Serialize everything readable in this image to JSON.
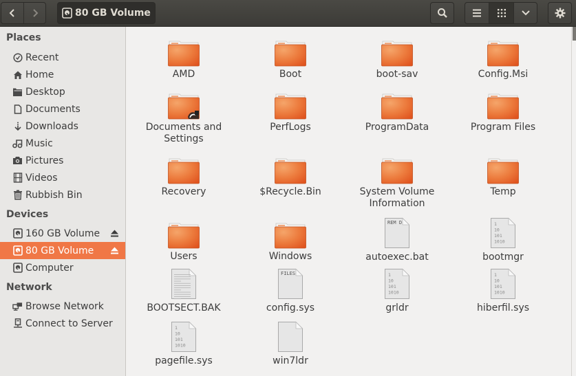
{
  "header": {
    "back_icon": "chevron-left-icon",
    "forward_icon": "chevron-right-icon",
    "location": {
      "icon": "drive-harddisk-icon",
      "label": "80 GB Volume"
    },
    "search_icon": "search-icon",
    "view_list_icon": "list-view-icon",
    "view_grid_icon": "grid-view-icon",
    "view_options_icon": "chevron-down-icon",
    "menu_icon": "gear-icon",
    "active_view": "grid"
  },
  "sidebar": {
    "places_heading": "Places",
    "places": [
      {
        "label": "Recent",
        "icon": "clock-icon"
      },
      {
        "label": "Home",
        "icon": "home-icon"
      },
      {
        "label": "Desktop",
        "icon": "folder-icon"
      },
      {
        "label": "Documents",
        "icon": "document-icon"
      },
      {
        "label": "Downloads",
        "icon": "download-icon"
      },
      {
        "label": "Music",
        "icon": "music-icon"
      },
      {
        "label": "Pictures",
        "icon": "camera-icon"
      },
      {
        "label": "Videos",
        "icon": "film-icon"
      },
      {
        "label": "Rubbish Bin",
        "icon": "trash-icon"
      }
    ],
    "devices_heading": "Devices",
    "devices": [
      {
        "label": "160 GB Volume",
        "icon": "drive-harddisk-icon",
        "eject": true,
        "selected": false
      },
      {
        "label": "80 GB Volume",
        "icon": "drive-harddisk-icon",
        "eject": true,
        "selected": true
      },
      {
        "label": "Computer",
        "icon": "drive-harddisk-icon",
        "eject": false,
        "selected": false
      }
    ],
    "network_heading": "Network",
    "network": [
      {
        "label": "Browse Network",
        "icon": "network-icon"
      },
      {
        "label": "Connect to Server",
        "icon": "server-icon"
      }
    ]
  },
  "files": [
    {
      "name": "AMD",
      "type": "folder"
    },
    {
      "name": "Boot",
      "type": "folder"
    },
    {
      "name": "boot-sav",
      "type": "folder"
    },
    {
      "name": "Config.Msi",
      "type": "folder"
    },
    {
      "name": "Documents and Settings",
      "type": "folder-link"
    },
    {
      "name": "PerfLogs",
      "type": "folder"
    },
    {
      "name": "ProgramData",
      "type": "folder"
    },
    {
      "name": "Program Files",
      "type": "folder"
    },
    {
      "name": "Recovery",
      "type": "folder"
    },
    {
      "name": "$Recycle.Bin",
      "type": "folder"
    },
    {
      "name": "System Volume Information",
      "type": "folder"
    },
    {
      "name": "Temp",
      "type": "folder"
    },
    {
      "name": "Users",
      "type": "folder"
    },
    {
      "name": "Windows",
      "type": "folder"
    },
    {
      "name": "autoexec.bat",
      "type": "script",
      "preview": "REM D"
    },
    {
      "name": "bootmgr",
      "type": "binary",
      "preview": "1\n10\n101\n1010"
    },
    {
      "name": "BOOTSECT.BAK",
      "type": "text"
    },
    {
      "name": "config.sys",
      "type": "script",
      "preview": "FILES"
    },
    {
      "name": "grldr",
      "type": "binary",
      "preview": "1\n10\n101\n1010"
    },
    {
      "name": "hiberfil.sys",
      "type": "binary",
      "preview": "1\n10\n101\n1010"
    },
    {
      "name": "pagefile.sys",
      "type": "binary",
      "preview": "1\n10\n101\n1010"
    },
    {
      "name": "win7ldr",
      "type": "blank"
    }
  ],
  "colors": {
    "accent": "#f07746",
    "folder_top": "#f5a56a",
    "folder_bottom": "#e0541f",
    "header_bg": "#3c3b37"
  }
}
